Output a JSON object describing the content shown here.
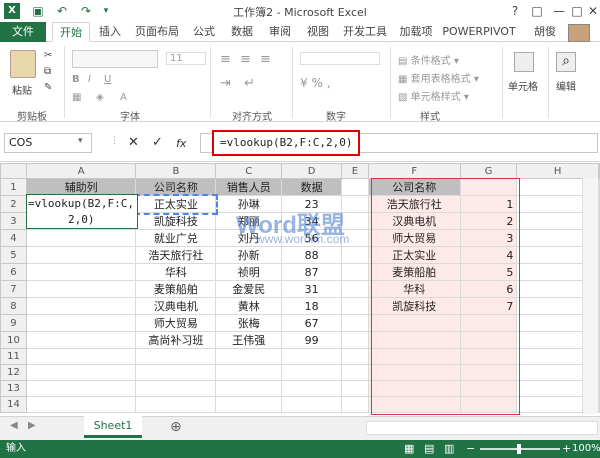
{
  "title": "工作簿2 - Microsoft Excel",
  "window": {
    "help": "?",
    "restore": "□",
    "minimize": "—",
    "maximize": "□",
    "close": "✕"
  },
  "tabs": [
    "文件",
    "开始",
    "插入",
    "页面布局",
    "公式",
    "数据",
    "审阅",
    "视图",
    "开发工具",
    "加载项",
    "POWERPIVOT"
  ],
  "user": "胡俊",
  "ribbon": {
    "paste": "粘贴",
    "clipboard": "剪贴板",
    "font": "字体",
    "font_size": "11",
    "alignment": "对齐方式",
    "number": "数字",
    "styles": "样式",
    "cond_format": "条件格式",
    "table_format": "套用表格格式",
    "cell_style": "单元格样式",
    "cells": "单元格",
    "edit": "编辑"
  },
  "formula_bar": {
    "name_box": "COS",
    "cancel": "✕",
    "enter": "✓",
    "fx": "fx",
    "formula": "=vlookup(B2,F:C,2,0)"
  },
  "columns": [
    "A",
    "B",
    "C",
    "D",
    "E",
    "F",
    "G",
    "H"
  ],
  "rows": [
    [
      "辅助列",
      "公司名称",
      "销售人员",
      "数据",
      "",
      "公司名称",
      "",
      ""
    ],
    [
      "",
      "正太实业",
      "孙琳",
      "23",
      "",
      "浩天旅行社",
      "1",
      ""
    ],
    [
      "",
      "凯旋科技",
      "郑丽",
      "34",
      "",
      "汉典电机",
      "2",
      ""
    ],
    [
      "",
      "就业广兑",
      "刘丹",
      "56",
      "",
      "师大贸易",
      "3",
      ""
    ],
    [
      "",
      "浩天旅行社",
      "孙新",
      "88",
      "",
      "正太实业",
      "4",
      ""
    ],
    [
      "",
      "华科",
      "祯明",
      "87",
      "",
      "麦策船舶",
      "5",
      ""
    ],
    [
      "",
      "麦策船舶",
      "金爱民",
      "31",
      "",
      "华科",
      "6",
      ""
    ],
    [
      "",
      "汉典电机",
      "黄林",
      "18",
      "",
      "凯旋科技",
      "7",
      ""
    ],
    [
      "",
      "师大贸易",
      "张梅",
      "67",
      "",
      "",
      "",
      ""
    ],
    [
      "",
      "高尚补习班",
      "王伟强",
      "99",
      "",
      "",
      "",
      ""
    ],
    [
      "",
      "",
      "",
      "",
      "",
      "",
      "",
      ""
    ],
    [
      "",
      "",
      "",
      "",
      "",
      "",
      "",
      ""
    ],
    [
      "",
      "",
      "",
      "",
      "",
      "",
      "",
      ""
    ],
    [
      "",
      "",
      "",
      "",
      "",
      "",
      "",
      ""
    ]
  ],
  "edit_cell": {
    "line1": "=vlookup(B2,F:C,",
    "line2": "2,0)"
  },
  "watermark": {
    "main": "Word联盟",
    "sub": "www.wordlm.com"
  },
  "sheet": {
    "tab": "Sheet1",
    "add": "⊕"
  },
  "status": {
    "mode": "输入",
    "zoom": "100%"
  }
}
